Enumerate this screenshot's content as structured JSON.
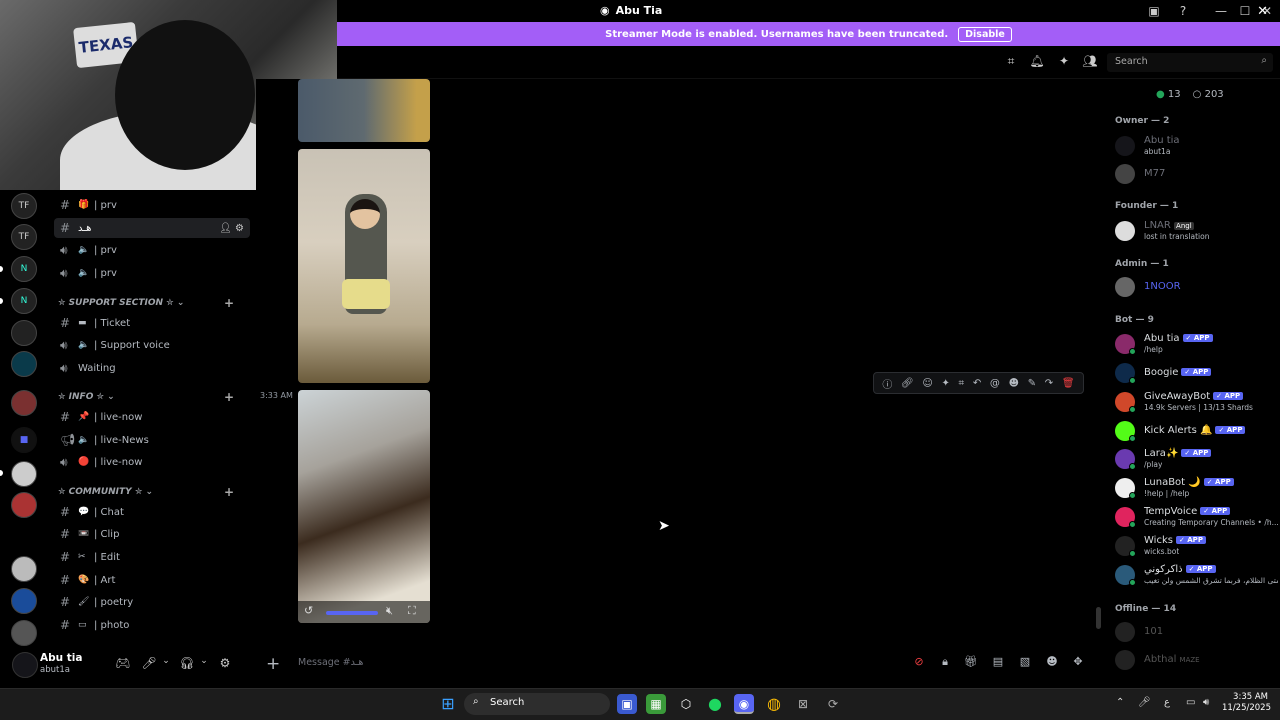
{
  "window": {
    "title": "Abu Tia"
  },
  "banner": {
    "text": "Streamer Mode is enabled. Usernames have been truncated.",
    "button": "Disable"
  },
  "search": {
    "placeholder": "Search"
  },
  "webcam": {
    "plate_text": "TEXAS"
  },
  "servers": [
    "TF",
    "TF",
    "N",
    "N",
    "",
    "",
    "",
    "",
    "",
    "",
    "",
    "",
    "",
    ""
  ],
  "channels": [
    {
      "type": "text",
      "emoji": "🎁",
      "name": "| prv"
    },
    {
      "type": "text",
      "emoji": "",
      "name": "هـد",
      "active": true
    },
    {
      "type": "voice",
      "emoji": "🔈",
      "name": "| prv"
    },
    {
      "type": "voice",
      "emoji": "🔈",
      "name": "| prv"
    }
  ],
  "categories": {
    "support": {
      "label": "✮ SUPPORT SECTION ✮",
      "channels": [
        {
          "type": "text",
          "emoji": "▬",
          "name": "| Ticket"
        },
        {
          "type": "voice",
          "emoji": "🔈",
          "name": "| Support voice"
        },
        {
          "type": "voice",
          "emoji": "",
          "name": "Waiting"
        }
      ]
    },
    "info": {
      "label": "✮ INFO ✮",
      "channels": [
        {
          "type": "text",
          "emoji": "📌",
          "name": "| live-now"
        },
        {
          "type": "news",
          "emoji": "🔈",
          "name": "| live-News"
        },
        {
          "type": "voice",
          "emoji": "🔴",
          "name": "| live-now"
        }
      ]
    },
    "community": {
      "label": "✮ COMMUNITY ✮",
      "channels": [
        {
          "type": "text",
          "emoji": "💬",
          "name": "| Chat"
        },
        {
          "type": "text",
          "emoji": "📼",
          "name": "| Clip"
        },
        {
          "type": "text",
          "emoji": "✂",
          "name": "| Edit"
        },
        {
          "type": "text",
          "emoji": "🎨",
          "name": "| Art"
        },
        {
          "type": "text",
          "emoji": "🖌",
          "name": "| poetry"
        },
        {
          "type": "text",
          "emoji": "▭",
          "name": "| photo"
        }
      ]
    }
  },
  "user": {
    "name": "Abu tia",
    "tag": "abut1a"
  },
  "message": {
    "time": "3:33 AM"
  },
  "composer": {
    "placeholder": "Message #هـد"
  },
  "members": {
    "counts": {
      "online": "13",
      "total": "203"
    },
    "groups": [
      {
        "label": "Owner — 2",
        "items": [
          {
            "name": "Abu tia",
            "sub": "abut1a",
            "color": "#6d6f78"
          },
          {
            "name": "M77",
            "sub": "",
            "color": "#6d6f78"
          }
        ]
      },
      {
        "label": "Founder — 1",
        "items": [
          {
            "name": "LNAR",
            "tag": "Angl",
            "sub": "lost in translation",
            "color": "#6d6f78"
          }
        ]
      },
      {
        "label": "Admin — 1",
        "items": [
          {
            "name": "1NOOR",
            "sub": "",
            "color": "#5865f2"
          }
        ]
      },
      {
        "label": "Bot — 9",
        "items": [
          {
            "name": "Abu tia",
            "app": "APP",
            "sub": "/help",
            "color": "#dbdee1"
          },
          {
            "name": "Boogie",
            "app": "APP",
            "sub": "",
            "color": "#dbdee1"
          },
          {
            "name": "GiveAwayBot",
            "app": "APP",
            "sub": "14.9k Servers | 13/13 Shards",
            "color": "#dbdee1"
          },
          {
            "name": "Kick Alerts 🔔",
            "app": "APP",
            "sub": "",
            "color": "#dbdee1"
          },
          {
            "name": "Lara✨",
            "app": "APP",
            "sub": "/play",
            "color": "#dbdee1"
          },
          {
            "name": "LunaBot 🌙",
            "app": "APP",
            "sub": "!help | /help",
            "color": "#dbdee1"
          },
          {
            "name": "TempVoice",
            "app": "APP",
            "sub": "Creating Temporary Channels • /h...",
            "color": "#dbdee1"
          },
          {
            "name": "Wicks",
            "app": "APP",
            "sub": "wicks.bot",
            "color": "#dbdee1"
          },
          {
            "name": "ذاكركوني",
            "app": "APP",
            "sub": "إلى متى الظلام، فربما تشرق الشمس ولن تغيب",
            "color": "#dbdee1"
          }
        ]
      },
      {
        "label": "Offline — 14",
        "items": [
          {
            "name": "101",
            "sub": "",
            "color": "#555"
          },
          {
            "name": "Abthal",
            "tag": "MAZE",
            "sub": "",
            "color": "#555"
          }
        ]
      }
    ]
  },
  "taskbar": {
    "search": "Search",
    "time": "3:35 AM",
    "date": "11/25/2025",
    "lang": "ع"
  }
}
